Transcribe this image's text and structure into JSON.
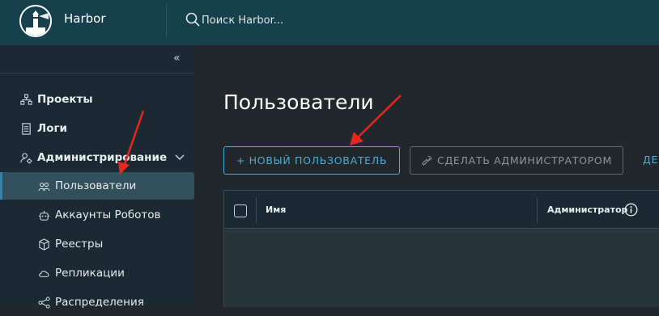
{
  "app": {
    "title": "Harbor"
  },
  "search": {
    "placeholder": "Поиск Harbor..."
  },
  "sidebar": {
    "items": [
      {
        "label": "Проекты",
        "icon": "projects-icon"
      },
      {
        "label": "Логи",
        "icon": "logs-icon"
      },
      {
        "label": "Администрирование",
        "icon": "admin-gear-icon",
        "expanded": true
      },
      {
        "label": "Пользователи",
        "icon": "users-icon",
        "active": true
      },
      {
        "label": "Аккаунты Роботов",
        "icon": "robot-icon"
      },
      {
        "label": "Реестры",
        "icon": "registry-box-icon"
      },
      {
        "label": "Репликации",
        "icon": "replication-cloud-icon"
      },
      {
        "label": "Распределения",
        "icon": "distribution-share-icon"
      }
    ]
  },
  "main": {
    "title": "Пользователи",
    "buttons": {
      "new_user": "+ НОВЫЙ ПОЛЬЗОВАТЕЛЬ",
      "make_admin": "СДЕЛАТЬ АДМИНИСТРАТОРОМ",
      "cut_off": "ДЕ"
    },
    "grid": {
      "columns": [
        "Имя",
        "Администратор"
      ]
    }
  },
  "colors": {
    "header": "#17404d",
    "sidebar": "#1b2a32",
    "content": "#21272b",
    "accent": "#4aaed9",
    "annotation": "#e8271c"
  }
}
